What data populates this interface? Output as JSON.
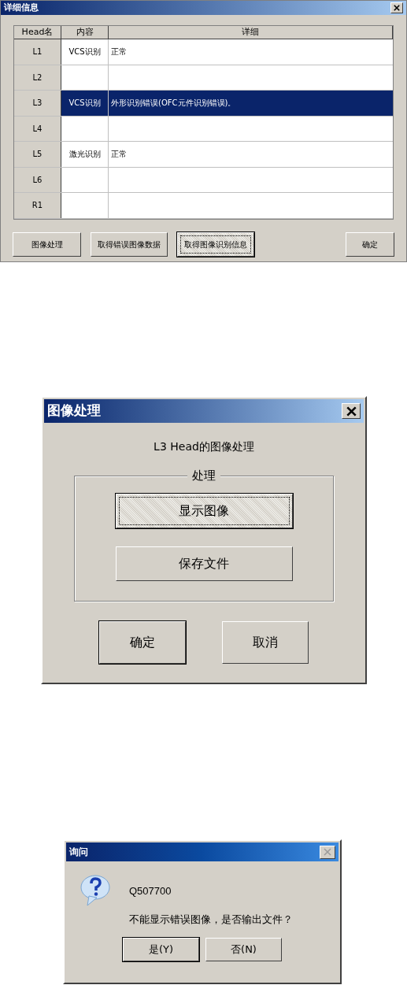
{
  "detail_window": {
    "title": "详细信息",
    "close_disabled": false,
    "columns": [
      "Head名",
      "内容",
      "详细"
    ],
    "rows": [
      {
        "head": "L1",
        "content": "VCS识别",
        "detail": "正常",
        "selected": false
      },
      {
        "head": "L2",
        "content": "",
        "detail": "",
        "selected": false
      },
      {
        "head": "L3",
        "content": "VCS识别",
        "detail": "外形识别错误(OFC元件识别错误)。",
        "selected": true
      },
      {
        "head": "L4",
        "content": "",
        "detail": "",
        "selected": false
      },
      {
        "head": "L5",
        "content": "激光识别",
        "detail": "正常",
        "selected": false
      },
      {
        "head": "L6",
        "content": "",
        "detail": "",
        "selected": false
      },
      {
        "head": "R1",
        "content": "",
        "detail": "",
        "selected": false
      }
    ],
    "buttons": [
      {
        "label": "图像处理",
        "focused": false
      },
      {
        "label": "取得错误图像数据",
        "focused": false
      },
      {
        "label": "取得图像识别信息",
        "focused": true
      }
    ],
    "ok_button": {
      "label": "确定",
      "focused": false
    }
  },
  "image_window": {
    "title": "图像处理",
    "close_disabled": false,
    "heading": "L3 Head的图像处理",
    "group_label": "处理",
    "group_buttons": [
      {
        "label": "显示图像",
        "focused": true
      },
      {
        "label": "保存文件",
        "focused": false
      }
    ],
    "buttons": [
      {
        "label": "确定",
        "default": true
      },
      {
        "label": "取消",
        "default": false
      }
    ]
  },
  "query_window": {
    "title": "询问",
    "close_disabled": true,
    "code": "Q507700",
    "message": "不能显示错误图像，是否输出文件？",
    "buttons": [
      {
        "label": "是(Y)",
        "default": true
      },
      {
        "label": "否(N)",
        "default": false
      }
    ]
  }
}
